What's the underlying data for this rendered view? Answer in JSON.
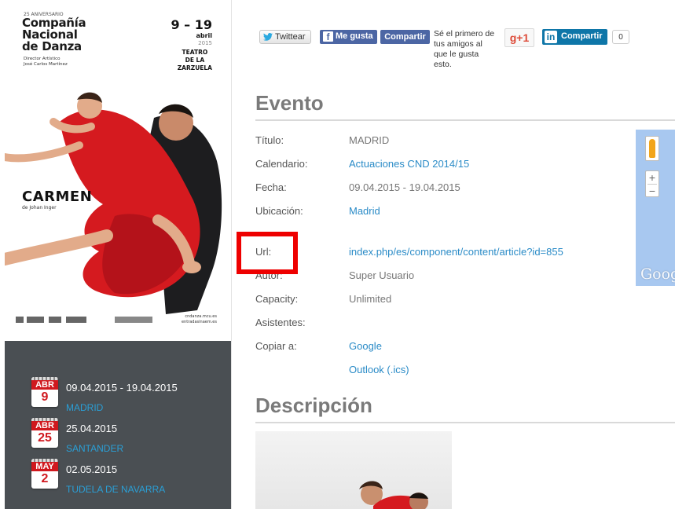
{
  "poster": {
    "anniversary": "25 ANIVERSARIO",
    "company_line1": "Compañía",
    "company_line2": "Nacional",
    "company_line3": "de Danza",
    "director_line1": "Director Artístico",
    "director_line2": "José Carlos Martínez",
    "dates": "9 – 19",
    "month": "abril",
    "year": "2015",
    "venue_line1": "TEATRO",
    "venue_line2": "DE LA",
    "venue_line3": "ZARZUELA",
    "show_title": "CARMEN",
    "show_author": "de Johan Inger",
    "contact_line1": "cndanza.mcu.es",
    "contact_line2": "entradasinaem.es"
  },
  "events": [
    {
      "month": "ABR",
      "day": "9",
      "dates": "09.04.2015 - 19.04.2015",
      "city": "MADRID"
    },
    {
      "month": "ABR",
      "day": "25",
      "dates": "25.04.2015",
      "city": "SANTANDER"
    },
    {
      "month": "MAY",
      "day": "2",
      "dates": "02.05.2015",
      "city": "TUDELA DE NAVARRA"
    }
  ],
  "share": {
    "twitter": "Twittear",
    "fb_like": "Me gusta",
    "fb_share": "Compartir",
    "fb_note": "Sé el primero de tus amigos al que le gusta esto.",
    "gplus": "g+1",
    "linkedin": "Compartir",
    "linkedin_count": "0"
  },
  "event_section": {
    "heading": "Evento",
    "rows": [
      {
        "label": "Título:",
        "value": "MADRID"
      },
      {
        "label": "Calendario:",
        "value": "Actuaciones CND 2014/15"
      },
      {
        "label": "Fecha:",
        "value": "09.04.2015 - 19.04.2015"
      },
      {
        "label": "Ubicación:",
        "value": "Madrid"
      },
      {
        "label": "Url:",
        "value": "index.php/es/component/content/article?id=855"
      },
      {
        "label": "Autor:",
        "value": "Super Usuario"
      },
      {
        "label": "Capacity:",
        "value": "Unlimited"
      },
      {
        "label": "Asistentes:",
        "value": ""
      },
      {
        "label": "Copiar a:",
        "value": "Google"
      },
      {
        "label": "",
        "value": "Outlook (.ics)"
      }
    ]
  },
  "map": {
    "zoom_in": "+",
    "zoom_out": "−",
    "watermark": "Goog"
  },
  "description_section": {
    "heading": "Descripción"
  },
  "colors": {
    "accent_link": "#2a8bc7",
    "sidebar_bg": "#4a4f53",
    "city_link": "#2a9fd6",
    "highlight": "#ee0000"
  }
}
